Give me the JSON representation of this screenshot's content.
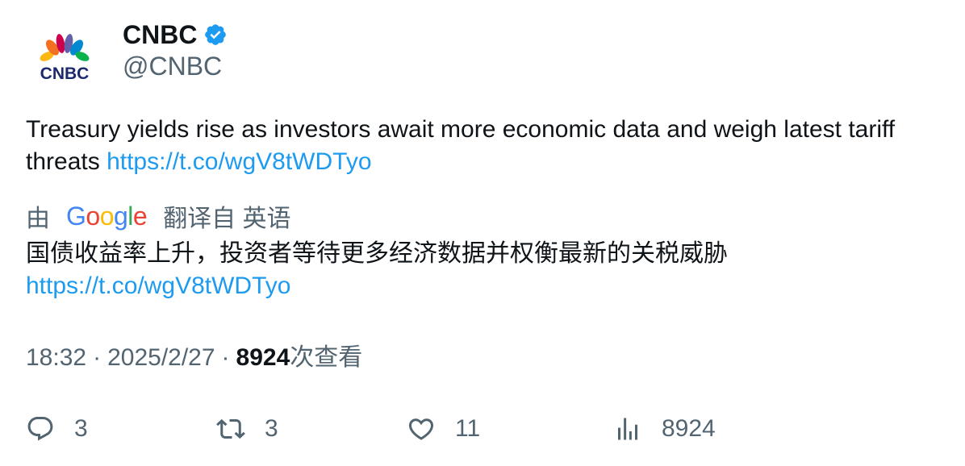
{
  "author": {
    "logo_text": "CNBC",
    "display_name": "CNBC",
    "handle": "@CNBC",
    "verified": true
  },
  "tweet": {
    "text": "Treasury yields rise as investors await more economic data and weigh latest tariff threats ",
    "link": "https://t.co/wgV8tWDTyo"
  },
  "translation": {
    "prefix": "由",
    "provider": "Google",
    "suffix": "翻译自 英语",
    "text": "国债收益率上升，投资者等待更多经济数据并权衡最新的关税威胁",
    "link": "https://t.co/wgV8tWDTyo"
  },
  "meta": {
    "time": "18:32",
    "separator": "·",
    "date": "2025/2/27",
    "views_count": "8924",
    "views_label": "次查看"
  },
  "actions": {
    "replies": "3",
    "retweets": "3",
    "likes": "11",
    "views": "8924"
  },
  "colors": {
    "text": "#0f1419",
    "secondary": "#536471",
    "link": "#1d9bf0",
    "verified": "#1d9bf0"
  }
}
